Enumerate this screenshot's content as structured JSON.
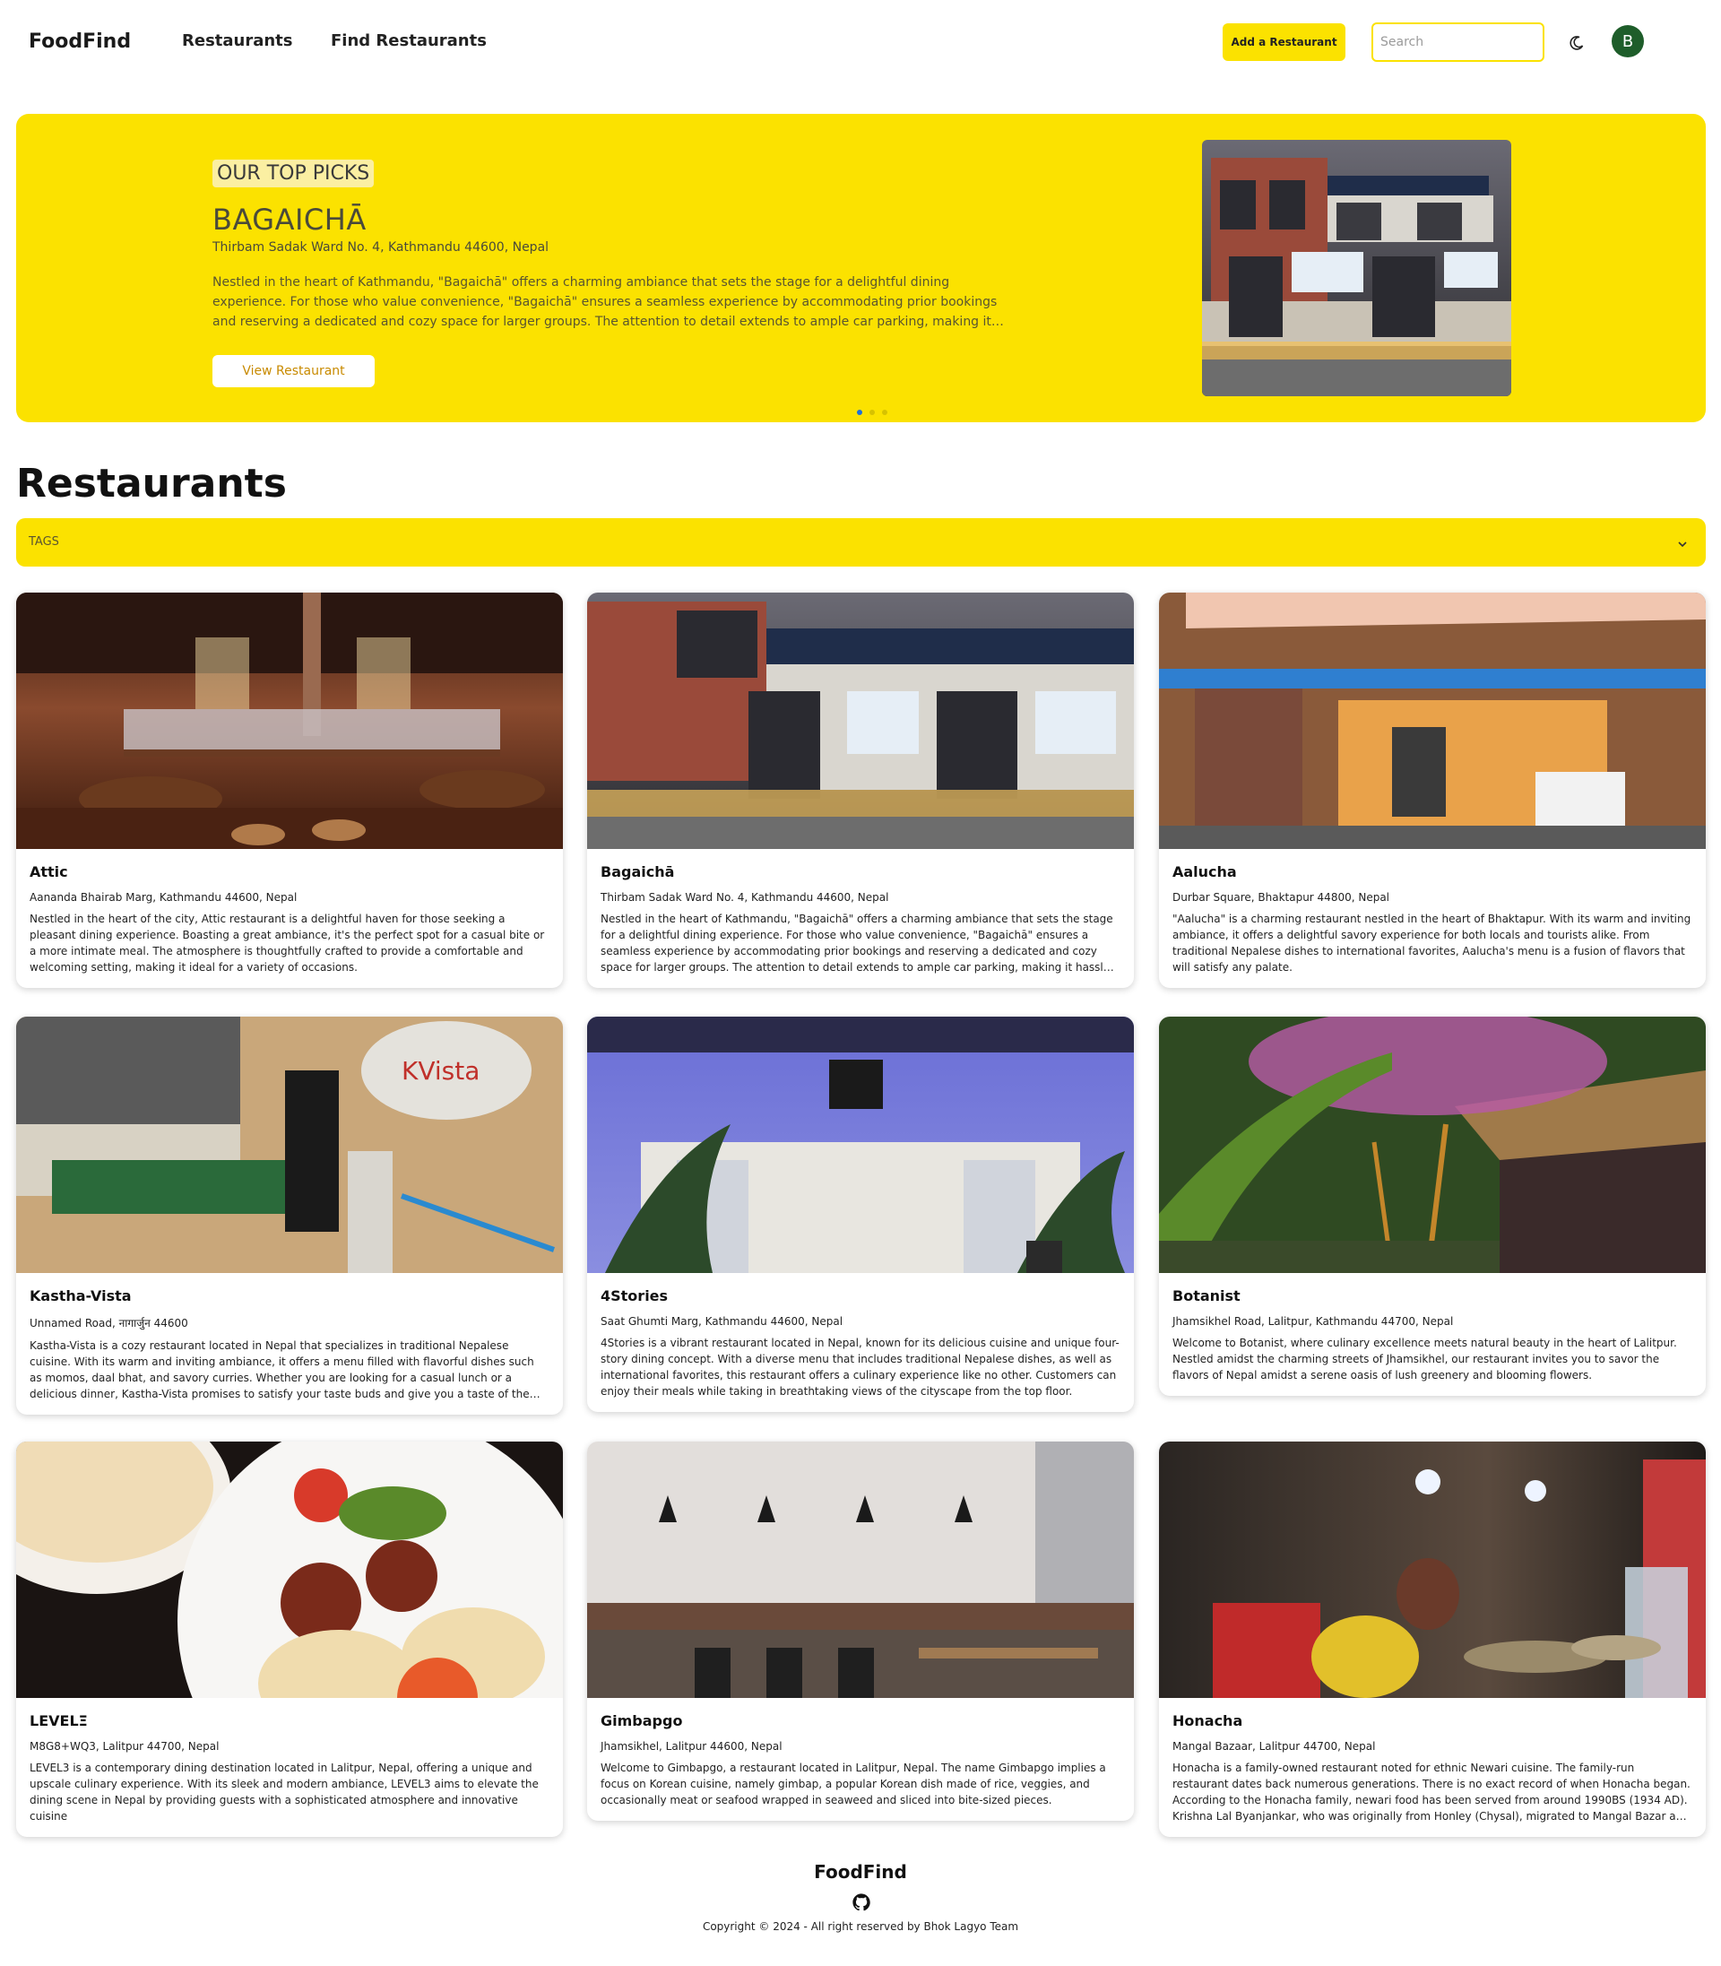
{
  "nav": {
    "brand": "FoodFind",
    "links": [
      "Restaurants",
      "Find Restaurants"
    ],
    "add_button": "Add a Restaurant",
    "search_placeholder": "Search",
    "avatar_initial": "B",
    "theme_icon": "moon-icon"
  },
  "hero": {
    "badge": "OUR TOP PICKS",
    "title": "BAGAICHĀ",
    "address": "Thirbam Sadak Ward No. 4, Kathmandu 44600, Nepal",
    "description": "Nestled in the heart of Kathmandu, \"Bagaichā\" offers a charming ambiance that sets the stage for a delightful dining experience. For those who value convenience, \"Bagaichā\" ensures a seamless experience by accommodating prior bookings and reserving a dedicated and cozy space for larger groups. The attention to detail extends to ample car parking, making it hassle-free for patrons to visit.",
    "button": "View Restaurant",
    "active_slide": 1,
    "slide_count": 3
  },
  "section": {
    "title": "Restaurants",
    "tags_label": "TAGS"
  },
  "restaurants": [
    {
      "name": "Attic",
      "address": "Aananda Bhairab Marg, Kathmandu 44600, Nepal",
      "description": "Nestled in the heart of the city, Attic restaurant is a delightful haven for those seeking a pleasant dining experience. Boasting a great ambiance, it's the perfect spot for a casual bite or a more intimate meal. The atmosphere is thoughtfully crafted to provide a comfortable and welcoming setting, making it ideal for a variety of occasions.",
      "image": "attic-bar-photo"
    },
    {
      "name": "Bagaichā",
      "address": "Thirbam Sadak Ward No. 4, Kathmandu 44600, Nepal",
      "description": "Nestled in the heart of Kathmandu, \"Bagaichā\" offers a charming ambiance that sets the stage for a delightful dining experience. For those who value convenience, \"Bagaichā\" ensures a seamless experience by accommodating prior bookings and reserving a dedicated and cozy space for larger groups. The attention to detail extends to ample car parking, making it hassle-free for patrons to visit.",
      "image": "bagaicha-building-photo"
    },
    {
      "name": "Aalucha",
      "address": "Durbar Square, Bhaktapur 44800, Nepal",
      "description": "\"Aalucha\" is a charming restaurant nestled in the heart of Bhaktapur. With its warm and inviting ambiance, it offers a delightful savory experience for both locals and tourists alike. From traditional Nepalese dishes to international favorites, Aalucha's menu is a fusion of flavors that will satisfy any palate.",
      "image": "aalucha-storefront-photo"
    },
    {
      "name": "Kastha-Vista",
      "address": "Unnamed Road, नागार्जुन 44600",
      "description": "Kastha-Vista is a cozy restaurant located in Nepal that specializes in traditional Nepalese cuisine. With its warm and inviting ambiance, it offers a menu filled with flavorful dishes such as momos, daal bhat, and savory curries. Whether you are looking for a casual lunch or a delicious dinner, Kastha-Vista promises to satisfy your taste buds and give you a taste of the authentic flavors of Nepal.",
      "image": "kastha-vista-counter-photo"
    },
    {
      "name": "4Stories",
      "address": "Saat Ghumti Marg, Kathmandu 44600, Nepal",
      "description": "4Stories is a vibrant restaurant located in Nepal, known for its delicious cuisine and unique four-story dining concept. With a diverse menu that includes traditional Nepalese dishes, as well as international favorites, this restaurant offers a culinary experience like no other. Customers can enjoy their meals while taking in breathtaking views of the cityscape from the top floor.",
      "image": "4stories-entrance-photo"
    },
    {
      "name": "Botanist",
      "address": "Jhamsikhel Road, Lalitpur, Kathmandu 44700, Nepal",
      "description": "Welcome to Botanist, where culinary excellence meets natural beauty in the heart of Lalitpur. Nestled amidst the charming streets of Jhamsikhel, our restaurant invites you to savor the flavors of Nepal amidst a serene oasis of lush greenery and blooming flowers.",
      "image": "botanist-garden-photo"
    },
    {
      "name": "LEVELΞ",
      "address": "M8G8+WQ3, Lalitpur 44700, Nepal",
      "description": "LEVEL3 is a contemporary dining destination located in Lalitpur, Nepal, offering a unique and upscale culinary experience. With its sleek and modern ambiance, LEVEL3 aims to elevate the dining scene in Nepal by providing guests with a sophisticated atmosphere and innovative cuisine",
      "image": "level3-falafel-plate-photo"
    },
    {
      "name": "Gimbapgo",
      "address": "Jhamsikhel, Lalitpur 44600, Nepal",
      "description": "Welcome to Gimbapgo, a restaurant located in Lalitpur, Nepal. The name Gimbapgo implies a focus on Korean cuisine, namely gimbap, a popular Korean dish made of rice, veggies, and occasionally meat or seafood wrapped in seaweed and sliced into bite-sized pieces.",
      "image": "gimbapgo-dining-room-photo"
    },
    {
      "name": "Honacha",
      "address": "Mangal Bazaar, Lalitpur 44700, Nepal",
      "description": "Honacha is a family-owned restaurant noted for ethnic Newari cuisine. The family-run restaurant dates back numerous generations. There is no exact record of when Honacha began. According to the Honacha family, newari food has been served from around 1990BS (1934 AD). Krishna Lal Byanjankar, who was originally from Honley (Chysal), migrated to Mangal Bazar and built a tiny restaurant.",
      "image": "honacha-kitchen-photo"
    }
  ],
  "footer": {
    "brand": "FoodFind",
    "copyright": "Copyright © 2024 - All right reserved by Bhok Lagyo Team",
    "github_icon": "github-icon"
  },
  "colors": {
    "accent_yellow": "#fbe200",
    "avatar_green": "#1e5d2a",
    "active_dot": "#1e6fd9"
  }
}
